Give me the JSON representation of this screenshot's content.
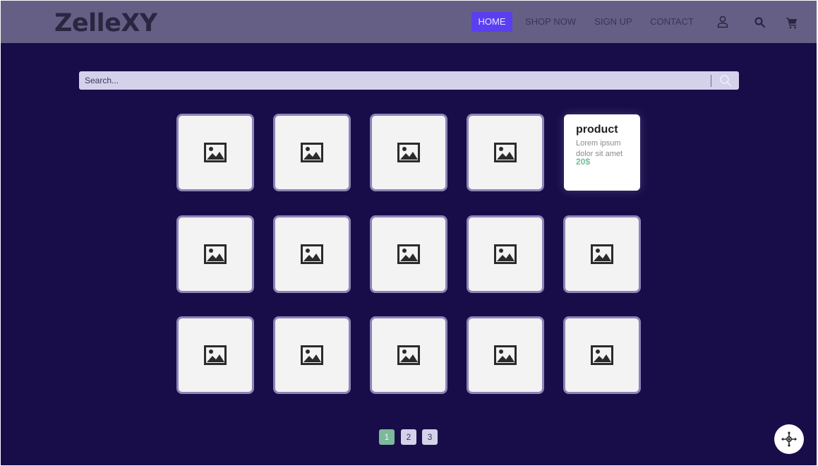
{
  "brand": {
    "logo": "ZelleXY"
  },
  "nav": {
    "links": [
      "HOME",
      "SHOP NOW",
      "SIGN UP",
      "CONTACT"
    ],
    "active": "HOME",
    "icons": [
      "user-icon",
      "search-icon",
      "cart-icon"
    ]
  },
  "search": {
    "placeholder": "Search..."
  },
  "products": {
    "hovered_card": {
      "title": "product",
      "description": "Lorem ipsum dolor sit amet",
      "price": "20$"
    },
    "placeholder_icon": "image-placeholder-icon",
    "rows": 3,
    "columns": 5
  },
  "pagination": {
    "pages": [
      "1",
      "2",
      "3"
    ],
    "current": "1"
  },
  "colors": {
    "background": "#190d49",
    "navbar": "#655f85",
    "active_link": "#5a3ff1",
    "card_border": "#8e84b8",
    "price": "#6fbf9a",
    "page_active": "#7cb99a"
  },
  "fab": {
    "icon": "accessibility-icon"
  }
}
